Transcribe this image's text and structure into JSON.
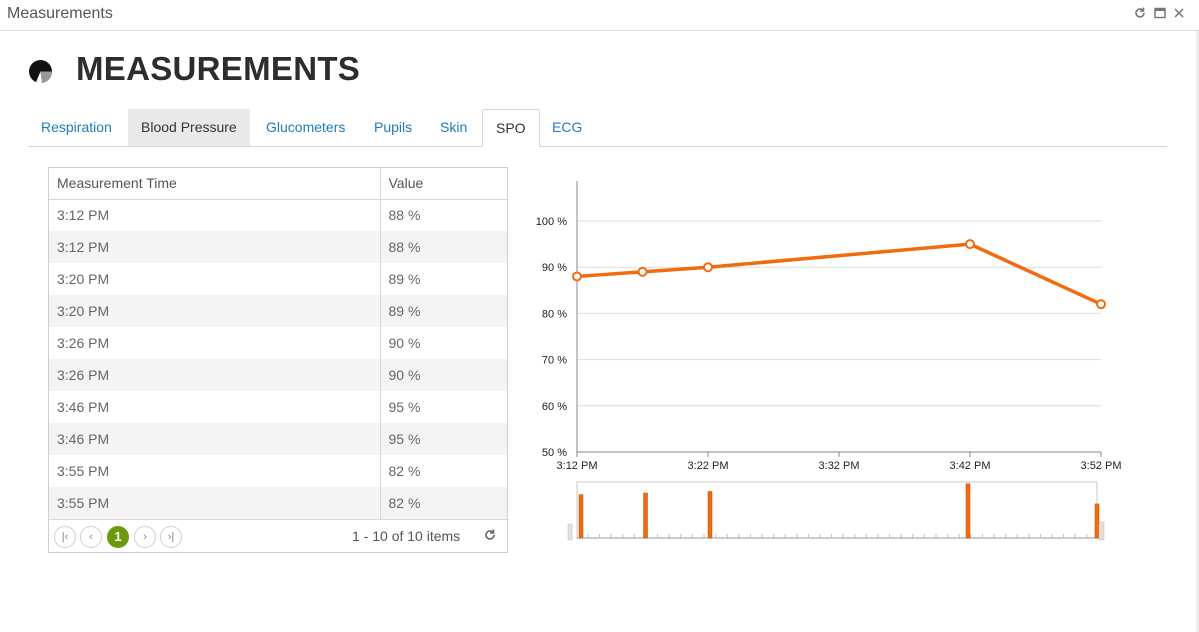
{
  "window": {
    "title": "Measurements"
  },
  "header": {
    "title": "MEASUREMENTS"
  },
  "tabs": [
    "Respiration",
    "Blood Pressure",
    "Glucometers",
    "Pupils",
    "Skin",
    "SPO",
    "ECG"
  ],
  "active_tab": "SPO",
  "grid": {
    "columns": [
      "Measurement Time",
      "Value"
    ],
    "rows": [
      [
        "3:12 PM",
        "88 %"
      ],
      [
        "3:12 PM",
        "88 %"
      ],
      [
        "3:20 PM",
        "89 %"
      ],
      [
        "3:20 PM",
        "89 %"
      ],
      [
        "3:26 PM",
        "90 %"
      ],
      [
        "3:26 PM",
        "90 %"
      ],
      [
        "3:46 PM",
        "95 %"
      ],
      [
        "3:46 PM",
        "95 %"
      ],
      [
        "3:55 PM",
        "82 %"
      ],
      [
        "3:55 PM",
        "82 %"
      ]
    ],
    "pager": {
      "current_page": "1",
      "info": "1 - 10 of 10 items"
    }
  },
  "colors": {
    "series": "#f26b0f",
    "tab_link": "#1f7cbf",
    "pager_active": "#6b9a0c"
  },
  "chart_data": {
    "type": "line",
    "x": [
      "3:12 PM",
      "3:20 PM",
      "3:26 PM",
      "3:46 PM",
      "3:55 PM"
    ],
    "values": [
      88,
      89,
      90,
      95,
      82
    ],
    "x_ticks": [
      "3:12 PM",
      "3:22 PM",
      "3:32 PM",
      "3:42 PM",
      "3:52 PM"
    ],
    "x_tick_minutes": [
      0,
      10,
      20,
      30,
      40
    ],
    "x_point_minutes": [
      0,
      5,
      10,
      30,
      40
    ],
    "y_ticks": [
      "50 %",
      "60 %",
      "70 %",
      "80 %",
      "90 %",
      "100 %"
    ],
    "ylim": [
      50,
      100
    ],
    "grid": true,
    "navigator": true
  }
}
